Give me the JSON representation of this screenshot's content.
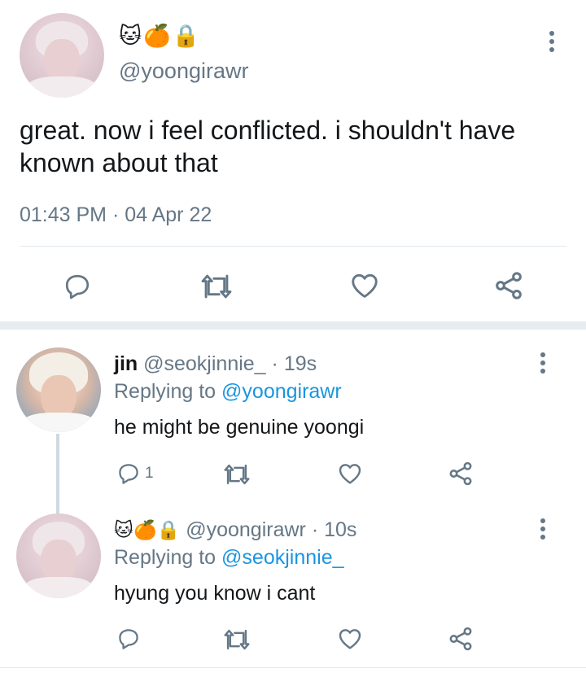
{
  "main_tweet": {
    "handle": "@yoongirawr",
    "name_emojis": "🐱🍊🔒",
    "text": "great. now i feel conflicted. i shouldn't have known about that",
    "timestamp": "01:43 PM · 04 Apr 22"
  },
  "replies": [
    {
      "name": "jin",
      "handle": "@seokjinnie_",
      "time": "· 19s",
      "replying_prefix": "Replying to",
      "replying_to": "@yoongirawr",
      "text": "he might be genuine yoongi",
      "reply_count": "1"
    },
    {
      "name_emojis": "🐱🍊🔒",
      "handle": "@yoongirawr",
      "time": "· 10s",
      "replying_prefix": "Replying to",
      "replying_to": "@seokjinnie_",
      "text": "hyung you know i cant",
      "reply_count": ""
    }
  ],
  "icons": [
    "reply-icon",
    "retweet-icon",
    "like-icon",
    "share-icon",
    "more-options-icon"
  ],
  "colors": {
    "text": "#14171a",
    "muted": "#657786",
    "link": "#1b95e0",
    "divider": "#e1e8ed",
    "thread_line": "#cfd9de"
  }
}
